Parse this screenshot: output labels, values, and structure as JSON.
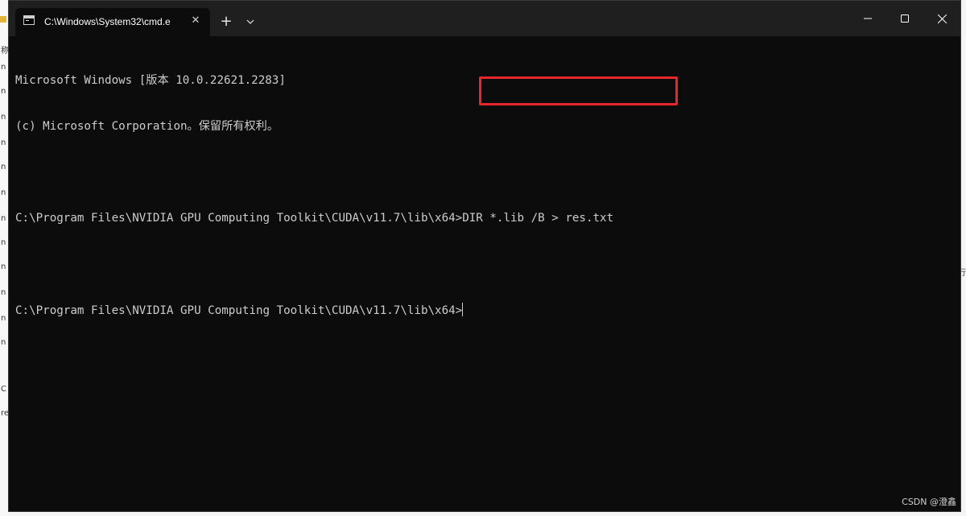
{
  "window": {
    "tab_title": "C:\\Windows\\System32\\cmd.e",
    "new_tab_symbol": "+",
    "tab_close_symbol": "✕",
    "icons": [
      "cmd-icon",
      "close-icon",
      "plus-icon",
      "chevron-down-icon",
      "minimize-icon",
      "maximize-icon",
      "close-window-icon"
    ]
  },
  "terminal": {
    "lines": [
      "Microsoft Windows [版本 10.0.22621.2283]",
      "(c) Microsoft Corporation。保留所有权利。",
      "",
      "C:\\Program Files\\NVIDIA GPU Computing Toolkit\\CUDA\\v11.7\\lib\\x64>DIR *.lib /B > res.txt",
      "",
      "C:\\Program Files\\NVIDIA GPU Computing Toolkit\\CUDA\\v11.7\\lib\\x64>"
    ]
  },
  "background": {
    "left_glyphs": [
      "称",
      "n",
      "n",
      "n",
      "n",
      "n",
      "n",
      "n",
      "n",
      "n",
      "n",
      "n",
      "n",
      "C",
      "re"
    ],
    "right_glyph": "行"
  },
  "watermark": "CSDN @澄鑫",
  "colors": {
    "terminal_bg": "#0c0c0c",
    "titlebar_bg": "#1f1f1f",
    "text": "#cccccc",
    "highlight": "#e8262b"
  }
}
